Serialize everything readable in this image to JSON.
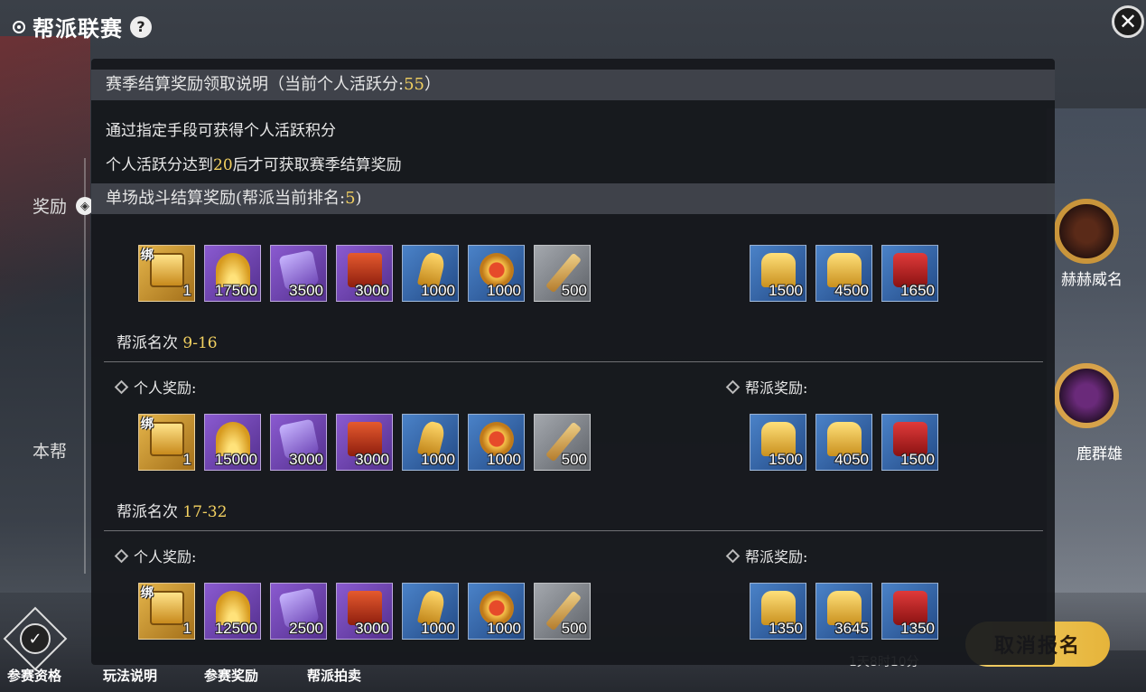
{
  "window": {
    "title": "帮派联赛",
    "help": "?",
    "close": "✕"
  },
  "side": {
    "rewards_label": "奖励",
    "our_gang_label": "本帮",
    "knob": "◈"
  },
  "right": {
    "medal1_label": "赫赫威名",
    "medal2_label": "鹿群雄"
  },
  "bottom": {
    "icon": "✓",
    "tabs": [
      "参赛资格",
      "玩法说明",
      "参赛奖励",
      "帮派拍卖"
    ],
    "cancel_button": "取消报名",
    "timer_text": "1天8时10分"
  },
  "panel": {
    "season_header": {
      "text": "赛季结算奖励领取说明（当前个人活跃分:",
      "value": "55",
      "close_paren": "）"
    },
    "line1": "通过指定手段可获得个人活跃积分",
    "line2": {
      "pre": "个人活跃分达到",
      "value": "20",
      "post": "后才可获取赛季结算奖励"
    },
    "battle_header": {
      "text": "单场战斗结算奖励(帮派当前排名:",
      "value": "5",
      "close_paren": ")"
    },
    "personal_label": "个人奖励:",
    "gang_label": "帮派奖励:",
    "bind_label": "绑",
    "tiers": [
      {
        "rank_label": "",
        "rank_value": "",
        "personal": [
          "1",
          "17500",
          "3500",
          "3000",
          "1000",
          "1000",
          "500"
        ],
        "gang": [
          "1500",
          "4500",
          "1650"
        ]
      },
      {
        "rank_label": "帮派名次 ",
        "rank_value": "9-16",
        "personal": [
          "1",
          "15000",
          "3000",
          "3000",
          "1000",
          "1000",
          "500"
        ],
        "gang": [
          "1500",
          "4050",
          "1500"
        ]
      },
      {
        "rank_label": "帮派名次 ",
        "rank_value": "17-32",
        "personal": [
          "1",
          "12500",
          "2500",
          "3000",
          "1000",
          "1000",
          "500"
        ],
        "gang": [
          "1350",
          "3645",
          "1350"
        ]
      }
    ],
    "personal_item_icons": [
      "treasure-chest-icon",
      "gold-leaf-icon",
      "purple-scroll-icon",
      "red-victory-tag-icon",
      "gold-token-icon",
      "red-coin-icon",
      "bronze-sword-icon"
    ],
    "gang_item_icons": [
      "gold-plaque-icon",
      "gold-medal-token-icon",
      "red-scroll-icon"
    ]
  }
}
